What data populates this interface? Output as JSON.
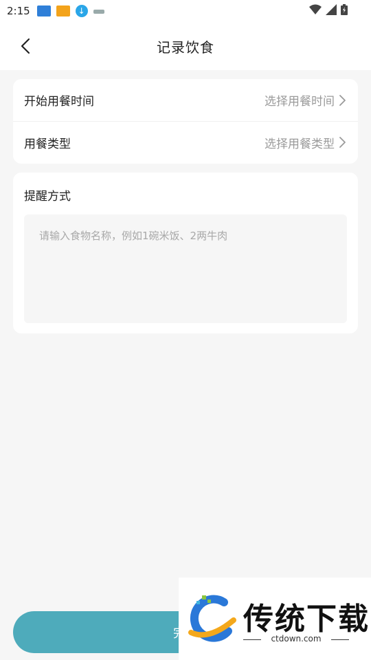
{
  "status_bar": {
    "time": "2:15",
    "icons": [
      "app-notification-icon",
      "app-notification-icon",
      "download-icon",
      "app-notification-icon",
      "wifi-icon",
      "signal-icon",
      "battery-icon"
    ]
  },
  "header": {
    "title": "记录饮食"
  },
  "meal_card": {
    "start_time": {
      "label": "开始用餐时间",
      "value": "选择用餐时间"
    },
    "meal_type": {
      "label": "用餐类型",
      "value": "选择用餐类型"
    }
  },
  "reminder_card": {
    "title": "提醒方式",
    "placeholder": "请输入食物名称，例如1碗米饭、2两牛肉"
  },
  "submit": {
    "label": "完成"
  },
  "watermark": {
    "brand": "传统下载",
    "url": "ctdown.com"
  },
  "colors": {
    "accent": "#4eabbb",
    "background": "#f6f6f6",
    "card": "#ffffff",
    "muted_text": "#9a9a9a"
  }
}
